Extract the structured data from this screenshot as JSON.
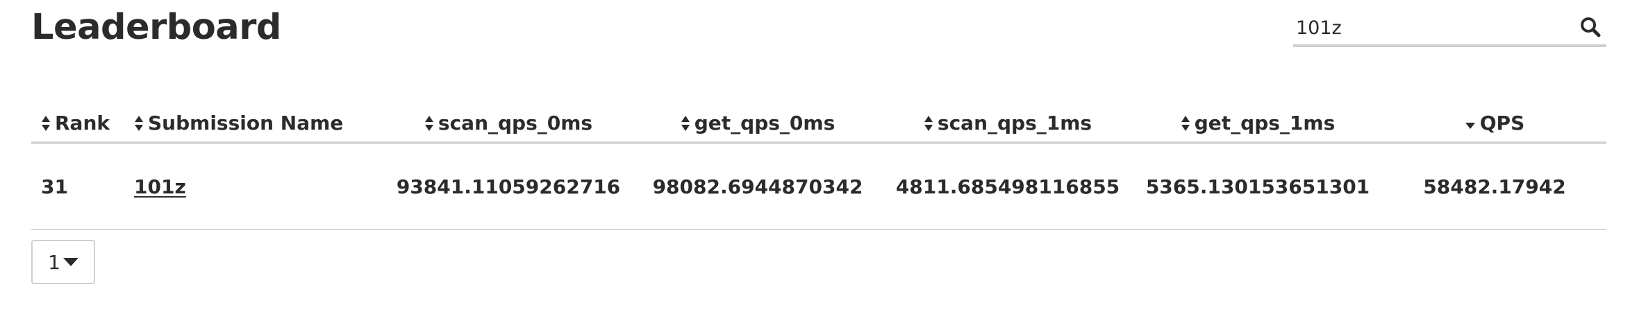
{
  "page": {
    "title": "Leaderboard"
  },
  "search": {
    "value": "101z",
    "icon": "search-icon"
  },
  "table": {
    "columns": [
      {
        "label": "Rank",
        "sort": "unsorted"
      },
      {
        "label": "Submission Name",
        "sort": "unsorted"
      },
      {
        "label": "scan_qps_0ms",
        "sort": "unsorted"
      },
      {
        "label": "get_qps_0ms",
        "sort": "unsorted"
      },
      {
        "label": "scan_qps_1ms",
        "sort": "unsorted"
      },
      {
        "label": "get_qps_1ms",
        "sort": "unsorted"
      },
      {
        "label": "QPS",
        "sort": "descending"
      }
    ],
    "rows": [
      {
        "rank": "31",
        "name": "101z",
        "scan_qps_0ms": "93841.11059262716",
        "get_qps_0ms": "98082.6944870342",
        "scan_qps_1ms": "4811.685498116855",
        "get_qps_1ms": "5365.130153651301",
        "qps": "58482.17942"
      }
    ]
  },
  "pagination": {
    "current_page": "1"
  },
  "colors": {
    "text": "#2b2b2b",
    "border": "#d6d6d6"
  }
}
